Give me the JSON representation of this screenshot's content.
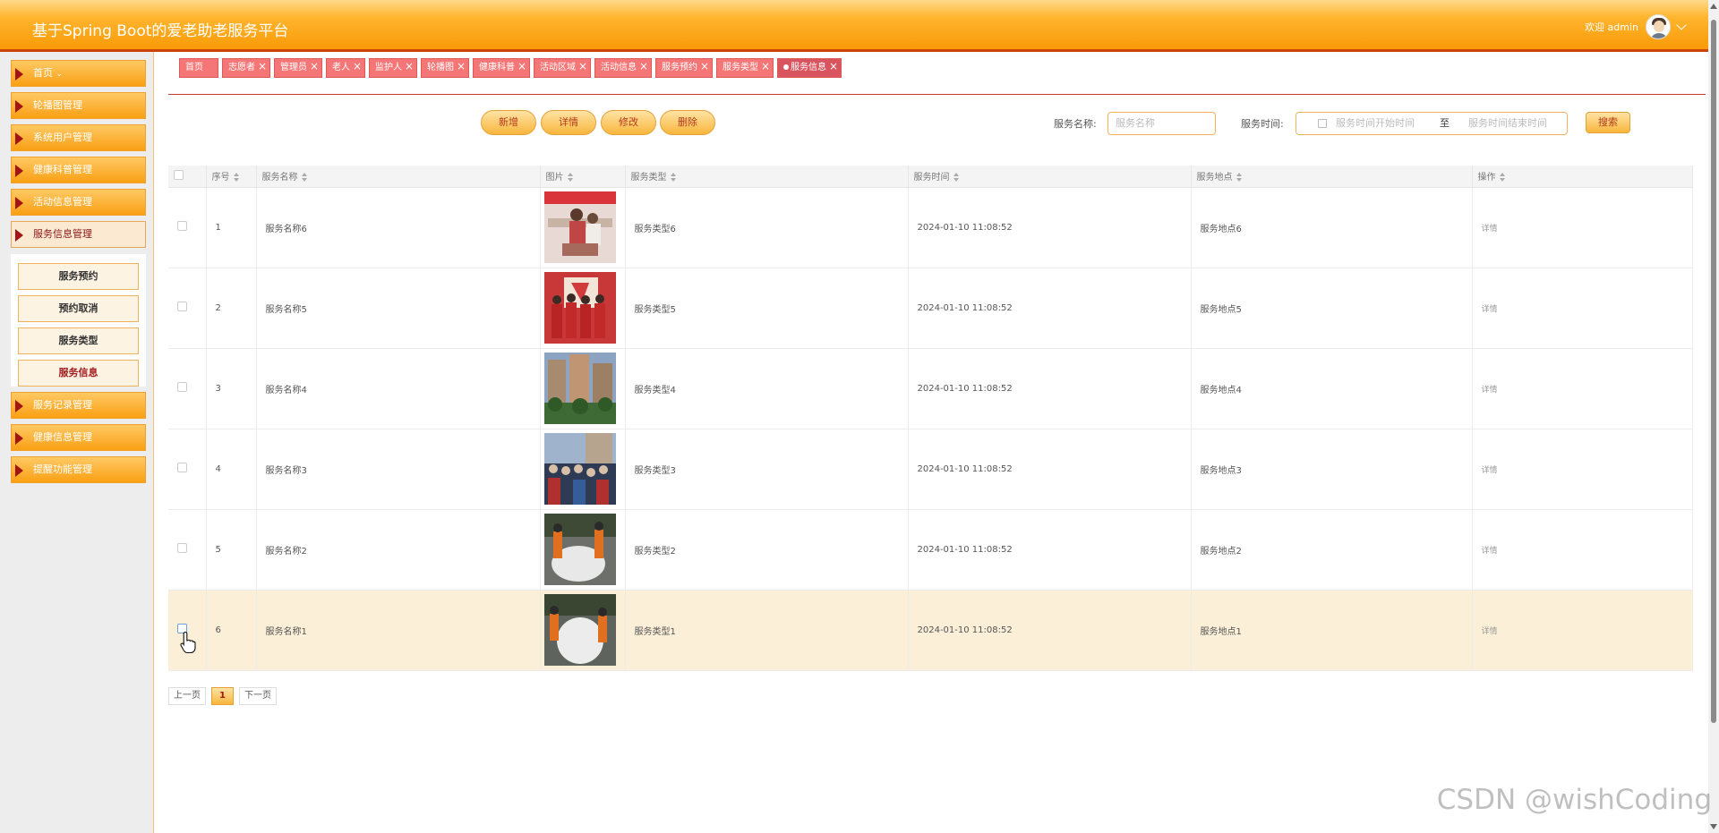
{
  "header": {
    "app_title": "基于Spring Boot的爱老助老服务平台",
    "welcome": "欢迎 admin"
  },
  "sidebar": {
    "items": [
      {
        "label": "首页"
      },
      {
        "label": "轮播图管理"
      },
      {
        "label": "系统用户管理"
      },
      {
        "label": "健康科普管理"
      },
      {
        "label": "活动信息管理"
      },
      {
        "label": "服务信息管理"
      },
      {
        "label": "服务记录管理"
      },
      {
        "label": "健康信息管理"
      },
      {
        "label": "提醒功能管理"
      }
    ],
    "submenu": [
      {
        "label": "服务预约"
      },
      {
        "label": "预约取消"
      },
      {
        "label": "服务类型"
      },
      {
        "label": "服务信息"
      }
    ]
  },
  "tabs": [
    "首页",
    "志愿者",
    "管理员",
    "老人",
    "监护人",
    "轮播图",
    "健康科普",
    "活动区域",
    "活动信息",
    "服务预约",
    "服务类型",
    "服务信息"
  ],
  "toolbar": {
    "add": "新增",
    "detail": "详情",
    "edit": "修改",
    "delete": "删除",
    "name_label": "服务名称:",
    "name_placeholder": "服务名称",
    "time_label": "服务时间:",
    "time_start_placeholder": "服务时间开始时间",
    "time_sep": "至",
    "time_end_placeholder": "服务时间结束时间",
    "search": "搜索"
  },
  "table": {
    "columns": [
      "序号",
      "服务名称",
      "图片",
      "服务类型",
      "服务时间",
      "服务地点",
      "操作"
    ],
    "rows": [
      {
        "index": "1",
        "name": "服务名称6",
        "type": "服务类型6",
        "time": "2024-01-10 11:08:52",
        "place": "服务地点6",
        "op": "详情"
      },
      {
        "index": "2",
        "name": "服务名称5",
        "type": "服务类型5",
        "time": "2024-01-10 11:08:52",
        "place": "服务地点5",
        "op": "详情"
      },
      {
        "index": "3",
        "name": "服务名称4",
        "type": "服务类型4",
        "time": "2024-01-10 11:08:52",
        "place": "服务地点4",
        "op": "详情"
      },
      {
        "index": "4",
        "name": "服务名称3",
        "type": "服务类型3",
        "time": "2024-01-10 11:08:52",
        "place": "服务地点3",
        "op": "详情"
      },
      {
        "index": "5",
        "name": "服务名称2",
        "type": "服务类型2",
        "time": "2024-01-10 11:08:52",
        "place": "服务地点2",
        "op": "详情"
      },
      {
        "index": "6",
        "name": "服务名称1",
        "type": "服务类型1",
        "time": "2024-01-10 11:08:52",
        "place": "服务地点1",
        "op": "详情"
      }
    ]
  },
  "pager": {
    "prev": "上一页",
    "current": "1",
    "next": "下一页"
  },
  "watermark": "CSDN @wishCoding",
  "colors": {
    "accent": "#f99a08",
    "tab": "#f47676",
    "active_text": "#a01d1d",
    "row_hover": "#fbefd8"
  }
}
